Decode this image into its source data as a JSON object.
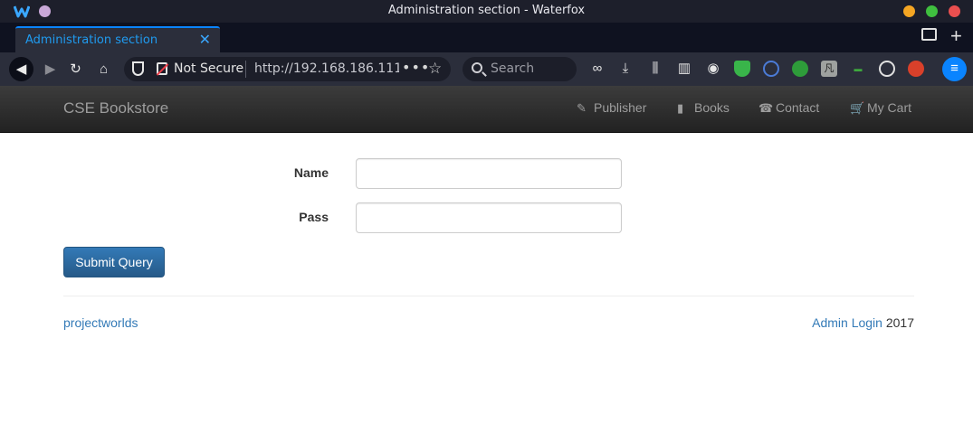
{
  "window": {
    "title": "Administration section - Waterfox"
  },
  "tab": {
    "label": "Administration section",
    "close_glyph": "✕"
  },
  "toolbar": {
    "security_label": "Not Secure",
    "url": "http://192.168.186.111/",
    "page_actions_glyph": "•••",
    "search_placeholder": "Search",
    "menu_glyph": "≡"
  },
  "site": {
    "brand": "CSE Bookstore",
    "nav": [
      {
        "label": "Publisher",
        "icon": "paperclip-icon"
      },
      {
        "label": "Books",
        "icon": "book-icon"
      },
      {
        "label": "Contact",
        "icon": "phone-icon"
      },
      {
        "label": "My Cart",
        "icon": "cart-icon"
      }
    ]
  },
  "form": {
    "name_label": "Name",
    "name_value": "",
    "pass_label": "Pass",
    "pass_value": "",
    "submit_label": "Submit Query"
  },
  "footer": {
    "left_link": "projectworlds",
    "admin_link": "Admin Login",
    "year": " 2017"
  },
  "colors": {
    "accent": "#0a84ff",
    "link": "#337ab7",
    "button": "#337ab7",
    "navbar": "#222222"
  }
}
